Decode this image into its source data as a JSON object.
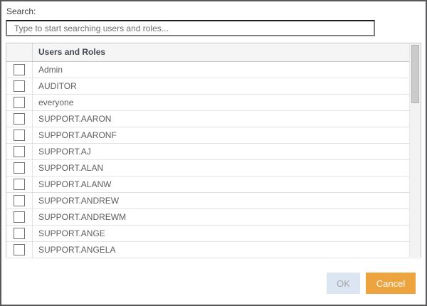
{
  "search": {
    "label": "Search:",
    "value": "",
    "placeholder": "Type to start searching users and roles..."
  },
  "table": {
    "header": "Users and Roles",
    "rows": [
      {
        "label": "Admin",
        "checked": false
      },
      {
        "label": "AUDITOR",
        "checked": false
      },
      {
        "label": "everyone",
        "checked": false
      },
      {
        "label": "SUPPORT.AARON",
        "checked": false
      },
      {
        "label": "SUPPORT.AARONF",
        "checked": false
      },
      {
        "label": "SUPPORT.AJ",
        "checked": false
      },
      {
        "label": "SUPPORT.ALAN",
        "checked": false
      },
      {
        "label": "SUPPORT.ALANW",
        "checked": false
      },
      {
        "label": "SUPPORT.ANDREW",
        "checked": false
      },
      {
        "label": "SUPPORT.ANDREWM",
        "checked": false
      },
      {
        "label": "SUPPORT.ANGE",
        "checked": false
      },
      {
        "label": "SUPPORT.ANGELA",
        "checked": false
      }
    ]
  },
  "buttons": {
    "ok": "OK",
    "ok_enabled": false,
    "cancel": "Cancel"
  },
  "colors": {
    "dialog_border": "#58585B",
    "header_bg": "#F5F5F5",
    "ok_button_bg": "#DBE6F2",
    "ok_button_text": "#A5A5A5",
    "cancel_button_bg": "#EDA43F",
    "cancel_button_text": "#FFFFFF"
  }
}
